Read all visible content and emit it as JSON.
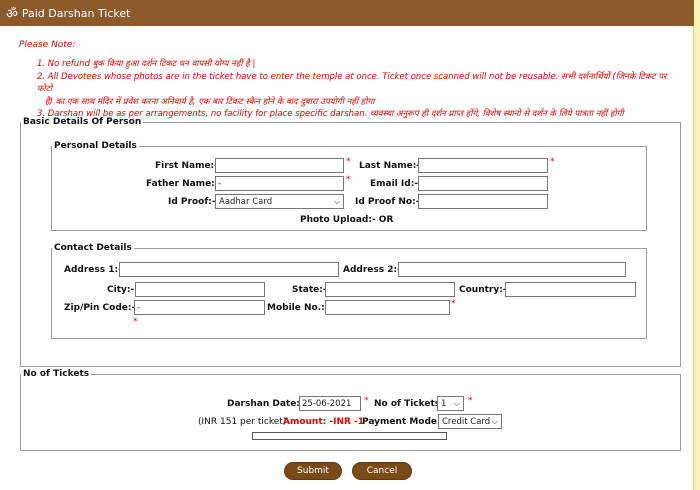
{
  "title": "Paid Darshan Ticket",
  "om_glyph": "ॐ",
  "note_head": "Please Note:",
  "notes": [
    "1. No refund बुक किया हुआ दर्शन टिकट धन वापसी योग्य नहीं है |",
    "2. All Devotees whose photos are in the ticket have to enter the temple at once. Ticket once scanned will not be reusable. सभी दर्शनार्थियों (जिनके टिकट पर फोटो",
    "है) का एक साथ मंदिर में प्रवेश करना अनिवार्य है, एक बार टिकट स्कैन होने के बाद दुबारा उपयोगी नहीं होगा",
    "3. Darshan will be as per arrangements, no facility for place specific darshan. व्यवस्था अनुरूप ही दर्शन प्राप्त होंगे, विशेष स्थानों से दर्शन के लिये पात्रता नहीं होगी"
  ],
  "basic": {
    "legend": "Basic Details Of Person",
    "personal": {
      "legend": "Personal Details",
      "first_name_label": "First Name:-",
      "first_name_value": "",
      "last_name_label": "Last Name:-",
      "last_name_value": "",
      "father_name_label": "Father Name:-",
      "father_name_value": "-",
      "email_label": "Email Id:-",
      "email_value": "",
      "id_proof_label": "Id Proof:-",
      "id_proof_selected": "Aadhar Card",
      "id_proof_no_label": "Id Proof No:-",
      "id_proof_no_value": "",
      "photo_upload": "Photo Upload:-  OR"
    },
    "contact": {
      "legend": "Contact Details",
      "address1_label": "Address 1:-",
      "address1_value": "",
      "address2_label": "Address 2:-",
      "address2_value": "",
      "city_label": "City:-",
      "city_value": "",
      "state_label": "State:-",
      "state_value": "",
      "country_label": "Country:-",
      "country_value": "",
      "zip_label": "Zip/Pin Code:-",
      "zip_value": "-",
      "mobile_label": "Mobile No.:-",
      "mobile_value": ""
    }
  },
  "tickets": {
    "legend": "No of Tickets",
    "date_label": "Darshan Date:-",
    "date_value": "25-06-2021",
    "count_label": "No of Tickets",
    "count_selected": "1",
    "price_note": "(INR 151 per ticket)",
    "amount": "Amount: -INR -1",
    "payment_label": "Payment Mode:-",
    "payment_selected": "Credit Card"
  },
  "required_mark": "*",
  "submit_label": "Submit",
  "cancel_label": "Cancel",
  "colors": {
    "titlebar": "#8b5a2b",
    "button": "#7a4a17",
    "note": "#dd0000",
    "page_bg": "#f7f2b8"
  }
}
